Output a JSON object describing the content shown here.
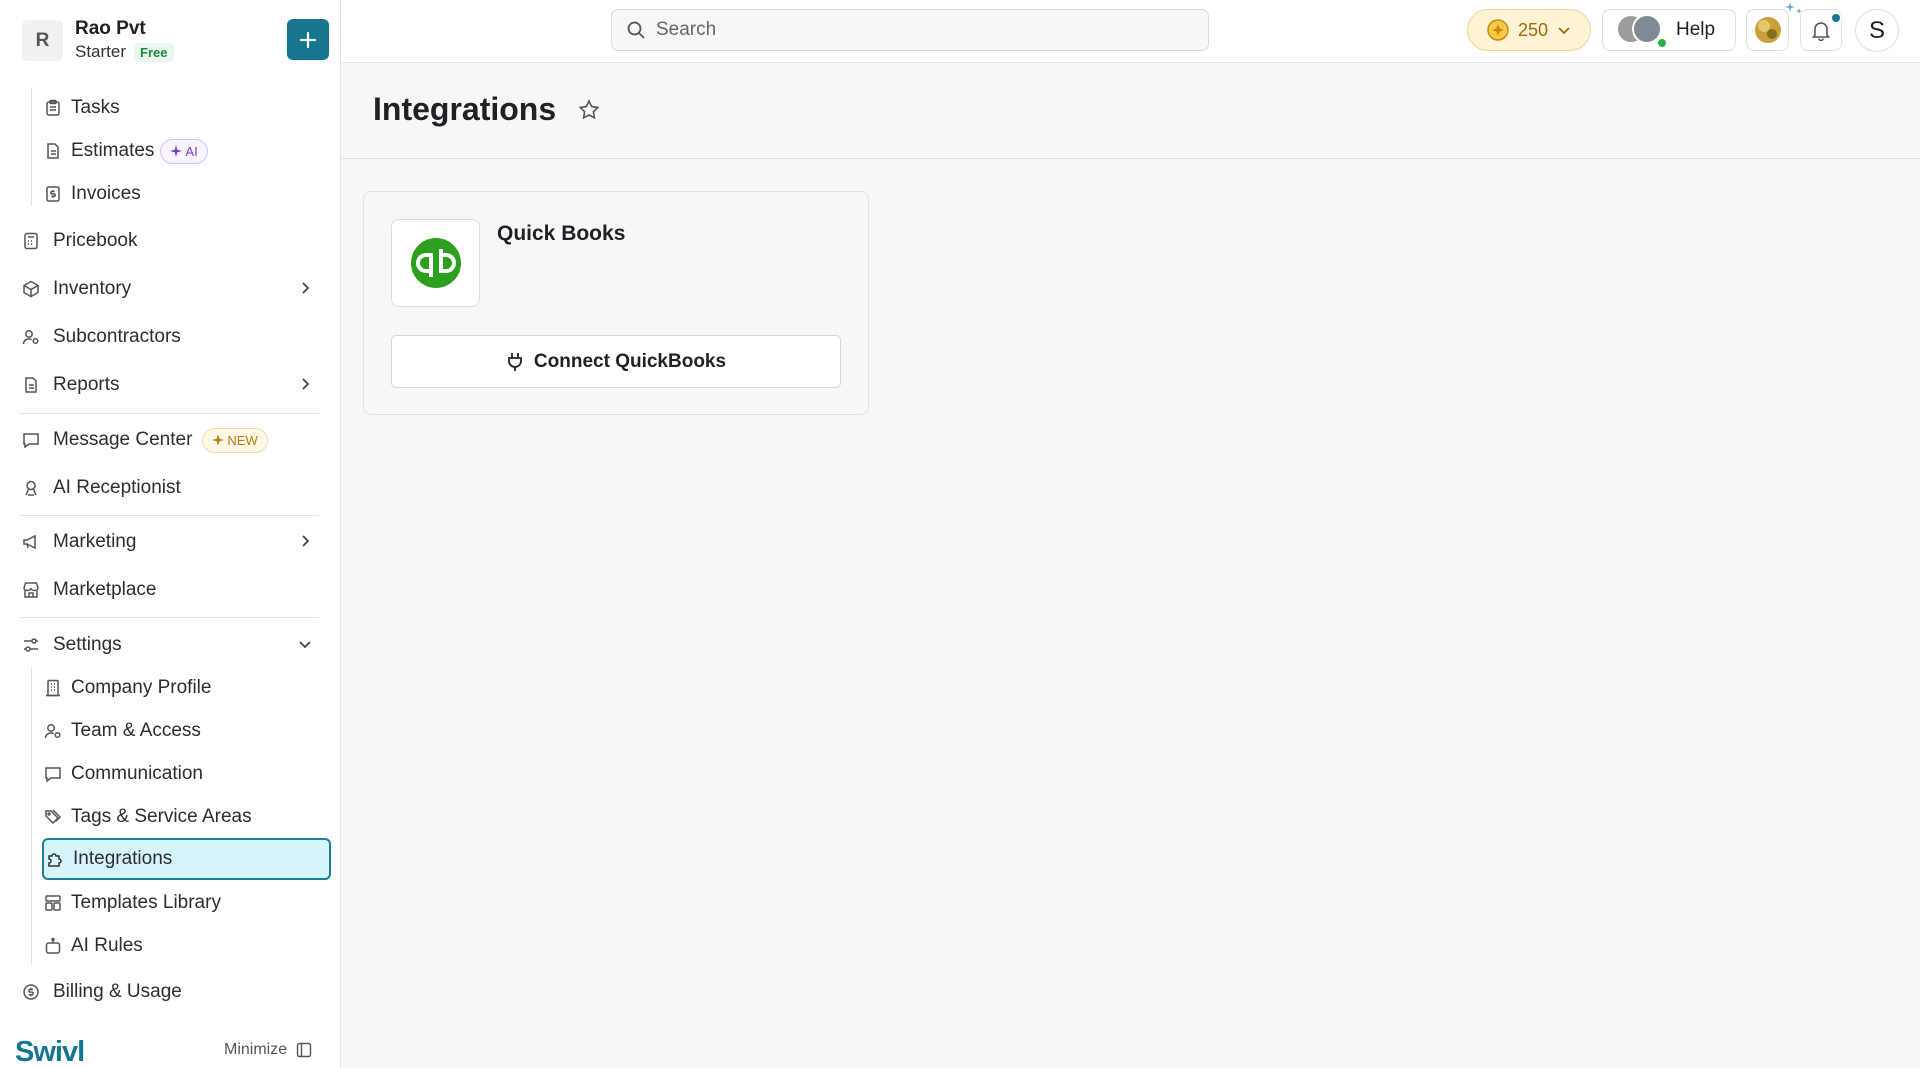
{
  "org": {
    "initial": "R",
    "name": "Rao Pvt",
    "plan": "Starter",
    "plan_badge": "Free"
  },
  "sidebar": {
    "tasks": "Tasks",
    "estimates": "Estimates",
    "estimates_badge": "AI",
    "invoices": "Invoices",
    "pricebook": "Pricebook",
    "inventory": "Inventory",
    "subcontractors": "Subcontractors",
    "reports": "Reports",
    "message_center": "Message Center",
    "message_center_badge": "NEW",
    "ai_receptionist": "AI Receptionist",
    "marketing": "Marketing",
    "marketplace": "Marketplace",
    "settings": "Settings",
    "company_profile": "Company Profile",
    "team_access": "Team & Access",
    "communication": "Communication",
    "tags_service_areas": "Tags & Service Areas",
    "integrations": "Integrations",
    "templates_library": "Templates Library",
    "ai_rules": "AI Rules",
    "billing_usage": "Billing & Usage"
  },
  "brand": "Swivl",
  "minimize_label": "Minimize",
  "topbar": {
    "search_placeholder": "Search",
    "coins": "250",
    "help_label": "Help",
    "user_initial": "S"
  },
  "page": {
    "title": "Integrations"
  },
  "integrations": [
    {
      "name": "Quick Books",
      "action_label": "Connect QuickBooks"
    }
  ],
  "colors": {
    "accent": "#167591",
    "active_bg": "#d6f5fb",
    "quickbooks_green": "#2ca01c"
  }
}
